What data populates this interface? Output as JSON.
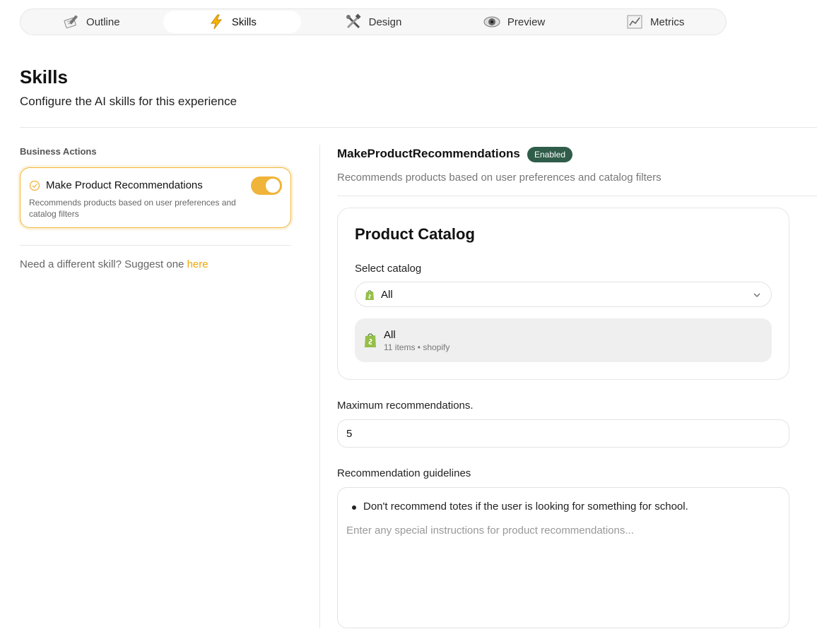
{
  "tabs": [
    {
      "label": "Outline",
      "icon": "memo-pencil-icon"
    },
    {
      "label": "Skills",
      "icon": "lightning-icon",
      "active": true
    },
    {
      "label": "Design",
      "icon": "tools-icon"
    },
    {
      "label": "Preview",
      "icon": "eye-icon"
    },
    {
      "label": "Metrics",
      "icon": "chart-icon"
    }
  ],
  "header": {
    "title": "Skills",
    "subtitle": "Configure the AI skills for this experience"
  },
  "sidebar": {
    "section_label": "Business Actions",
    "skill": {
      "name": "Make Product Recommendations",
      "description": "Recommends products based on user preferences and catalog filters",
      "enabled": true
    },
    "suggest_text": "Need a different skill? Suggest one",
    "suggest_link": "here"
  },
  "detail": {
    "title": "MakeProductRecommendations",
    "badge": "Enabled",
    "description": "Recommends products based on user preferences and catalog filters",
    "catalog": {
      "title": "Product Catalog",
      "select_label": "Select catalog",
      "selected_value": "All",
      "option_name": "All",
      "option_meta": "11 items • shopify"
    },
    "max_label": "Maximum recommendations.",
    "max_value": "5",
    "guidelines_label": "Recommendation guidelines",
    "guideline_item": "Don't recommend totes if the user is looking for something for school.",
    "guidelines_placeholder": "Enter any special instructions for product recommendations..."
  },
  "colors": {
    "accent": "#f0b43a",
    "badge_bg": "#2f5d4a",
    "link": "#f0a500",
    "shopify_green": "#95bf47"
  }
}
